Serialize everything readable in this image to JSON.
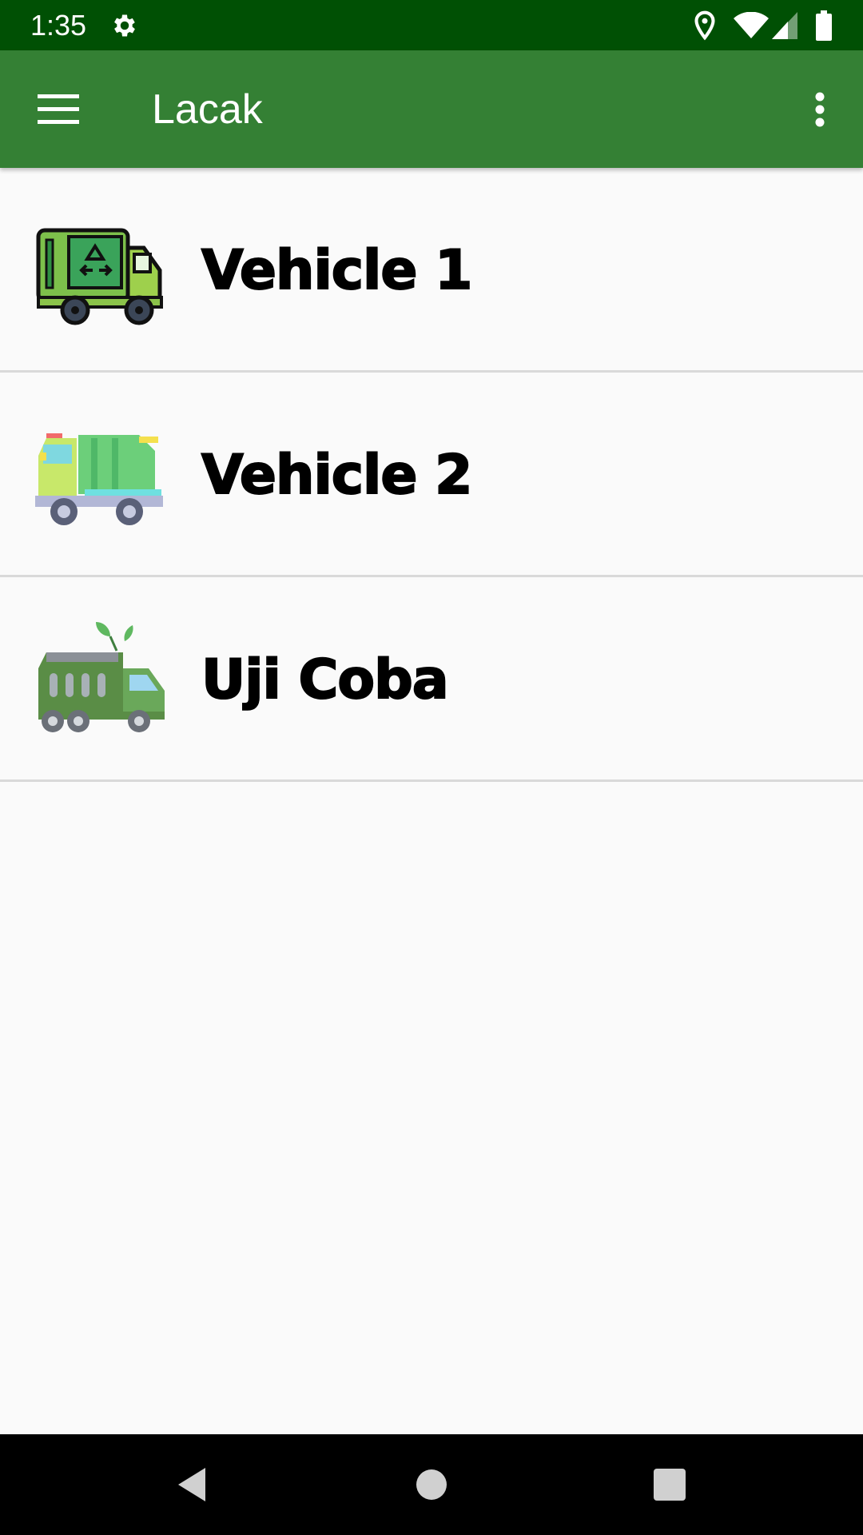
{
  "status_bar": {
    "time": "1:35",
    "left_icons": [
      "settings-icon"
    ],
    "right_icons": [
      "location-icon",
      "wifi-icon",
      "signal-icon",
      "battery-icon"
    ]
  },
  "app_bar": {
    "title": "Lacak",
    "menu_icon": "hamburger-menu-icon",
    "overflow_icon": "more-vert-icon",
    "color": "#348034"
  },
  "vehicles": [
    {
      "name": "Vehicle 1",
      "icon": "recycle-truck-icon"
    },
    {
      "name": "Vehicle 2",
      "icon": "garbage-truck-icon"
    },
    {
      "name": "Uji Coba",
      "icon": "eco-truck-icon"
    }
  ],
  "nav_bar": {
    "buttons": [
      "back-icon",
      "home-icon",
      "recents-icon"
    ]
  },
  "colors": {
    "status_bar": "#005004",
    "app_bar": "#348034",
    "background": "#fafafa",
    "divider": "#d9d9d9"
  }
}
